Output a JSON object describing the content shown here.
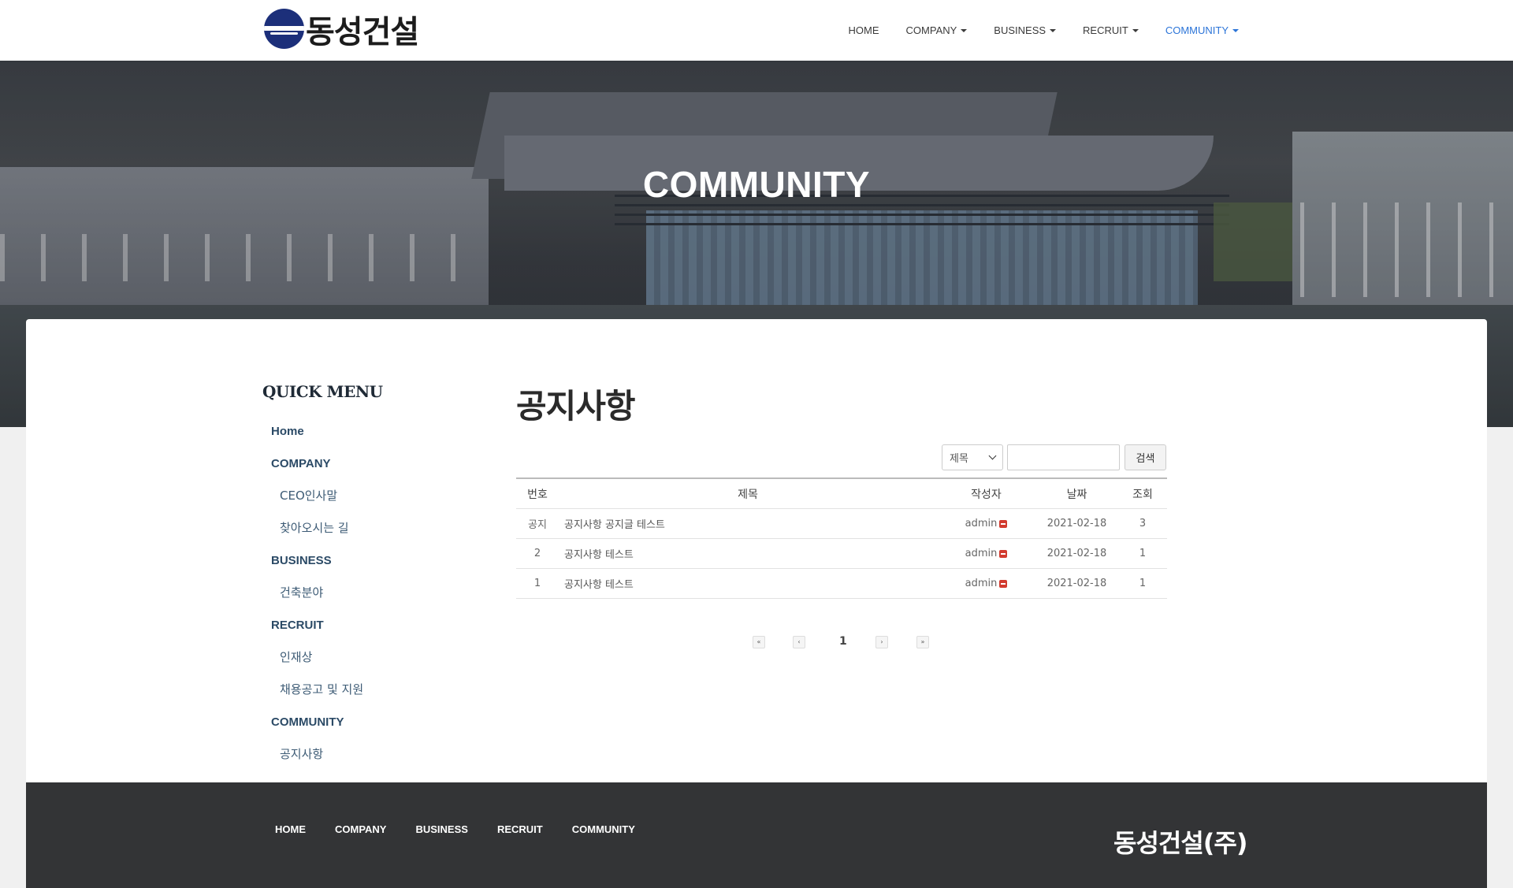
{
  "header": {
    "logo_text": "동성건설",
    "nav": [
      {
        "label": "HOME",
        "dropdown": false,
        "active": false
      },
      {
        "label": "COMPANY",
        "dropdown": true,
        "active": false
      },
      {
        "label": "BUSINESS",
        "dropdown": true,
        "active": false
      },
      {
        "label": "RECRUIT",
        "dropdown": true,
        "active": false
      },
      {
        "label": "COMMUNITY",
        "dropdown": true,
        "active": true
      }
    ]
  },
  "hero": {
    "title": "COMMUNITY"
  },
  "sidebar": {
    "title": "QUICK MENU",
    "items": [
      {
        "label": "Home",
        "type": "cat"
      },
      {
        "label": "COMPANY",
        "type": "cat"
      },
      {
        "label": "CEO인사말",
        "type": "sub"
      },
      {
        "label": "찾아오시는 길",
        "type": "sub"
      },
      {
        "label": "BUSINESS",
        "type": "cat"
      },
      {
        "label": "건축분야",
        "type": "sub"
      },
      {
        "label": "RECRUIT",
        "type": "cat"
      },
      {
        "label": "인재상",
        "type": "sub"
      },
      {
        "label": "채용공고 및 지원",
        "type": "sub"
      },
      {
        "label": "COMMUNITY",
        "type": "cat"
      },
      {
        "label": "공지사항",
        "type": "sub"
      }
    ]
  },
  "main": {
    "title": "공지사항",
    "search": {
      "select_value": "제목",
      "input_value": "",
      "button_label": "검색"
    },
    "table": {
      "headers": {
        "no": "번호",
        "title": "제목",
        "author": "작성자",
        "date": "날짜",
        "views": "조회"
      },
      "rows": [
        {
          "no": "공지",
          "title": "공지사항 공지글 테스트",
          "author": "admin",
          "date": "2021-02-18",
          "views": "3"
        },
        {
          "no": "2",
          "title": "공지사항 테스트",
          "author": "admin",
          "date": "2021-02-18",
          "views": "1"
        },
        {
          "no": "1",
          "title": "공지사항 테스트",
          "author": "admin",
          "date": "2021-02-18",
          "views": "1"
        }
      ]
    },
    "pagination": {
      "first": "«",
      "prev": "‹",
      "current": "1",
      "next": "›",
      "last": "»"
    }
  },
  "footer": {
    "nav": [
      "HOME",
      "COMPANY",
      "BUSINESS",
      "RECRUIT",
      "COMMUNITY"
    ],
    "brand": "동성건설(주)"
  },
  "colors": {
    "accent": "#2b74d8",
    "logo_blue": "#1c2f7a",
    "footer_bg": "#333436",
    "side_text": "#2b4a66"
  }
}
